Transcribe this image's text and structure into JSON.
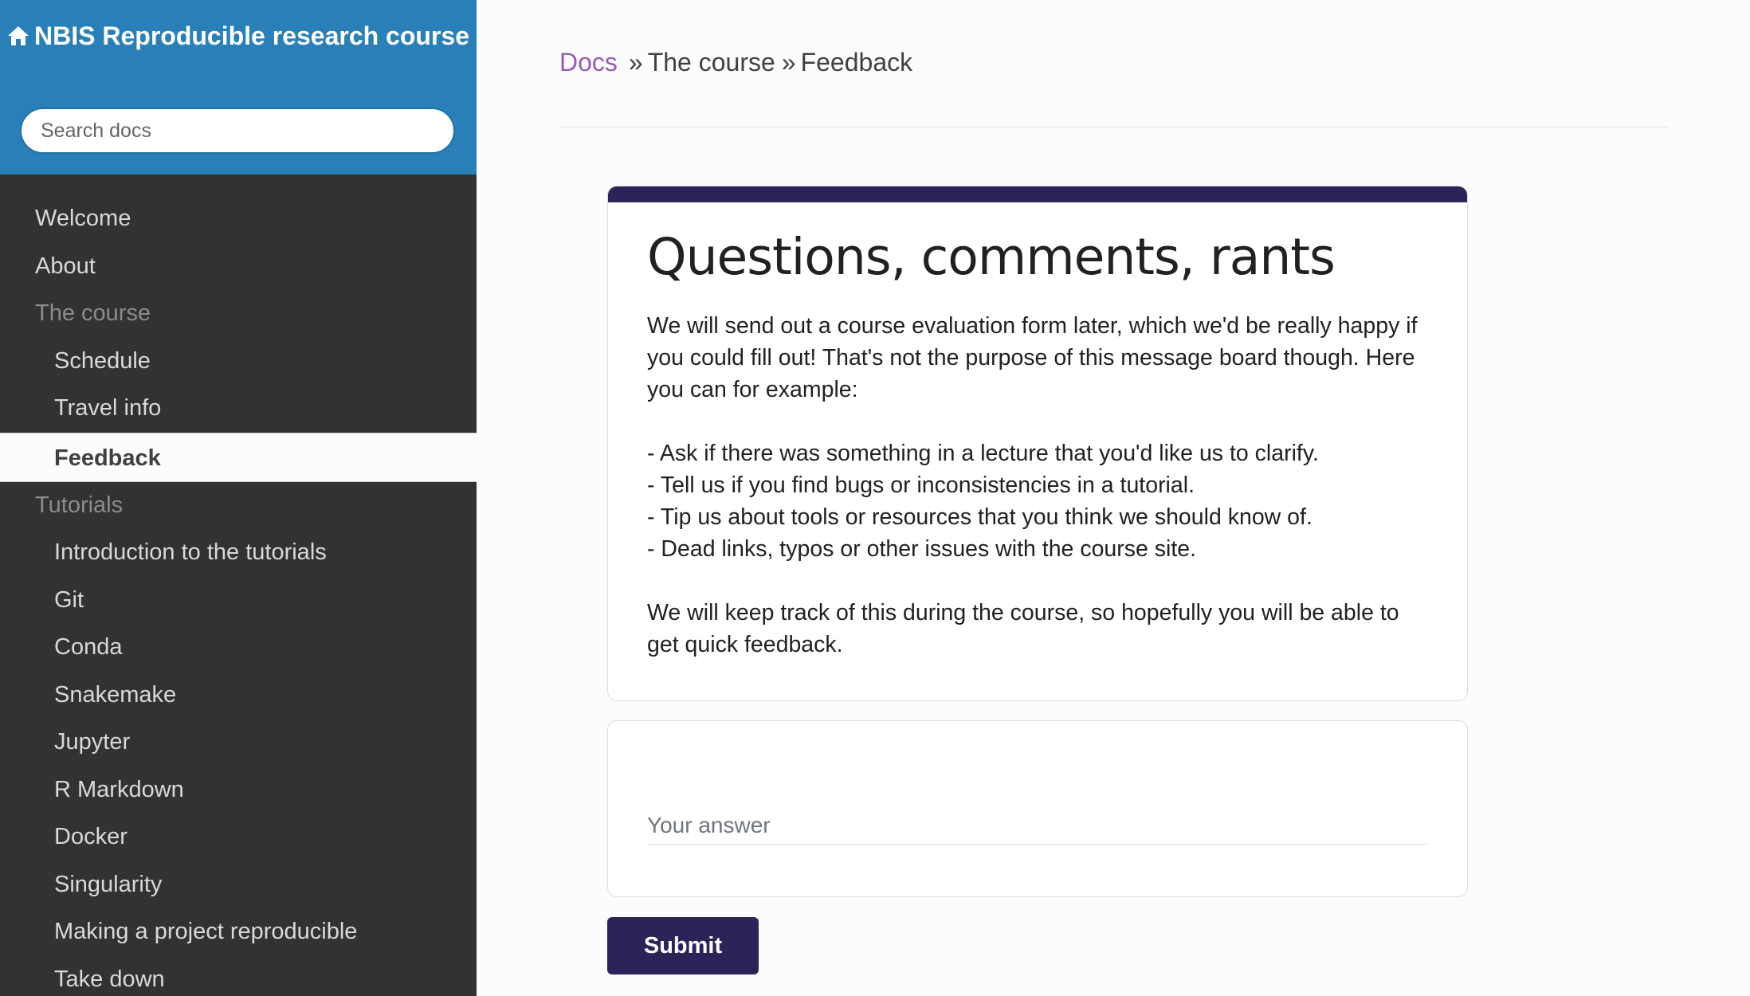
{
  "sidebar": {
    "site_title": "NBIS Reproducible research course",
    "home_icon": "home-icon",
    "search_placeholder": "Search docs",
    "items": [
      {
        "label": "Welcome",
        "level": 0
      },
      {
        "label": "About",
        "level": 0
      },
      {
        "label": "The course",
        "level": 0,
        "caption": true
      },
      {
        "label": "Schedule",
        "level": 1
      },
      {
        "label": "Travel info",
        "level": 1
      },
      {
        "label": "Feedback",
        "level": 1,
        "active": true
      },
      {
        "label": "Tutorials",
        "level": 0,
        "caption": true
      },
      {
        "label": "Introduction to the tutorials",
        "level": 1
      },
      {
        "label": "Git",
        "level": 1
      },
      {
        "label": "Conda",
        "level": 1
      },
      {
        "label": "Snakemake",
        "level": 1
      },
      {
        "label": "Jupyter",
        "level": 1
      },
      {
        "label": "R Markdown",
        "level": 1
      },
      {
        "label": "Docker",
        "level": 1
      },
      {
        "label": "Singularity",
        "level": 1
      },
      {
        "label": "Making a project reproducible",
        "level": 1
      },
      {
        "label": "Take down",
        "level": 1
      }
    ]
  },
  "breadcrumb": {
    "docs": "Docs",
    "sep": "»",
    "section": "The course",
    "page": "Feedback"
  },
  "form": {
    "title": "Questions, comments, rants",
    "description": "We will send out a course evaluation form later, which we'd be really happy if you could fill out! That's not the purpose of this message board though. Here you can for example:\n\n- Ask if there was something in a lecture that you'd like us to clarify.\n- Tell us if you find bugs or inconsistencies in a tutorial.\n- Tip us about tools or resources that you think we should know of.\n- Dead links, typos or other issues with the course site.\n\nWe will keep track of this during the course, so hopefully you will be able to get quick feedback.",
    "answer_placeholder": "Your answer",
    "submit_label": "Submit"
  },
  "colors": {
    "sidebar_top": "#2980b9",
    "sidebar_bg": "#343131",
    "link": "#9b59b6",
    "form_accent": "#2a2459"
  }
}
